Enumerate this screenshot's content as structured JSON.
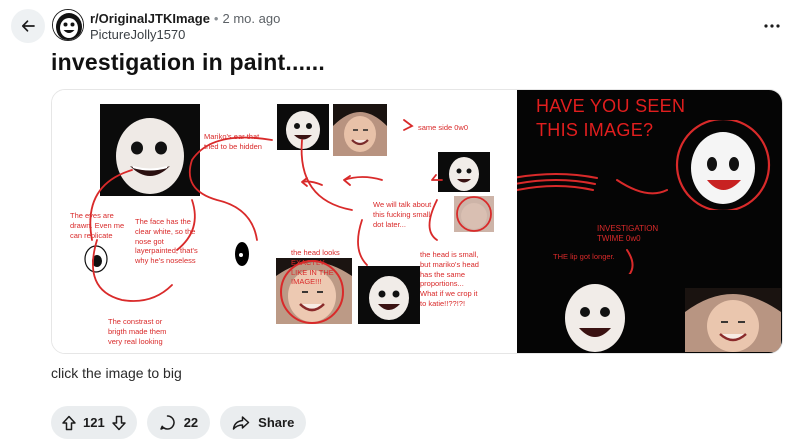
{
  "header": {
    "subreddit": "r/OriginalJTKImage",
    "separator": "•",
    "time_ago": "2 mo. ago",
    "author": "PictureJolly1570"
  },
  "post": {
    "title": "investigation in paint......",
    "caption": "click the image to big"
  },
  "image": {
    "notes": {
      "ear": "Mariko's ear that\ntried to be hidden",
      "same_side": "same side 0w0",
      "eyes": "The eyes are\ndrawn. Even me\ncan replicate",
      "face_white": "The face has the\nclear white, so the\nnose got\nlayerpainted, that's\nwhy he's noseless",
      "dot": "We will talk about\nthis fucking small\ndot later...",
      "head_looks": "the head looks\nEXACTLY\nLIKE IN THE\nIMAGE!!!",
      "head_small": "the head is small,\nbut mariko's head\nhas the same\nproportions...\nWhat if we crop it\nto katie!!??!?!",
      "contrast": "The constrast or\nbrigth made them\nvery real looking"
    },
    "right": {
      "headline": "HAVE YOU SEEN\nTHIS IMAGE?",
      "investigation": "INVESTIGATION\nTWIME 0w0",
      "lip": "THE lip got longer."
    }
  },
  "actions": {
    "vote_count": "121",
    "comment_count": "22",
    "share_label": "Share"
  },
  "colors": {
    "annotation_red": "#d92a2a",
    "pill_bg": "#eaedef",
    "back_bg": "#eef1f3"
  }
}
